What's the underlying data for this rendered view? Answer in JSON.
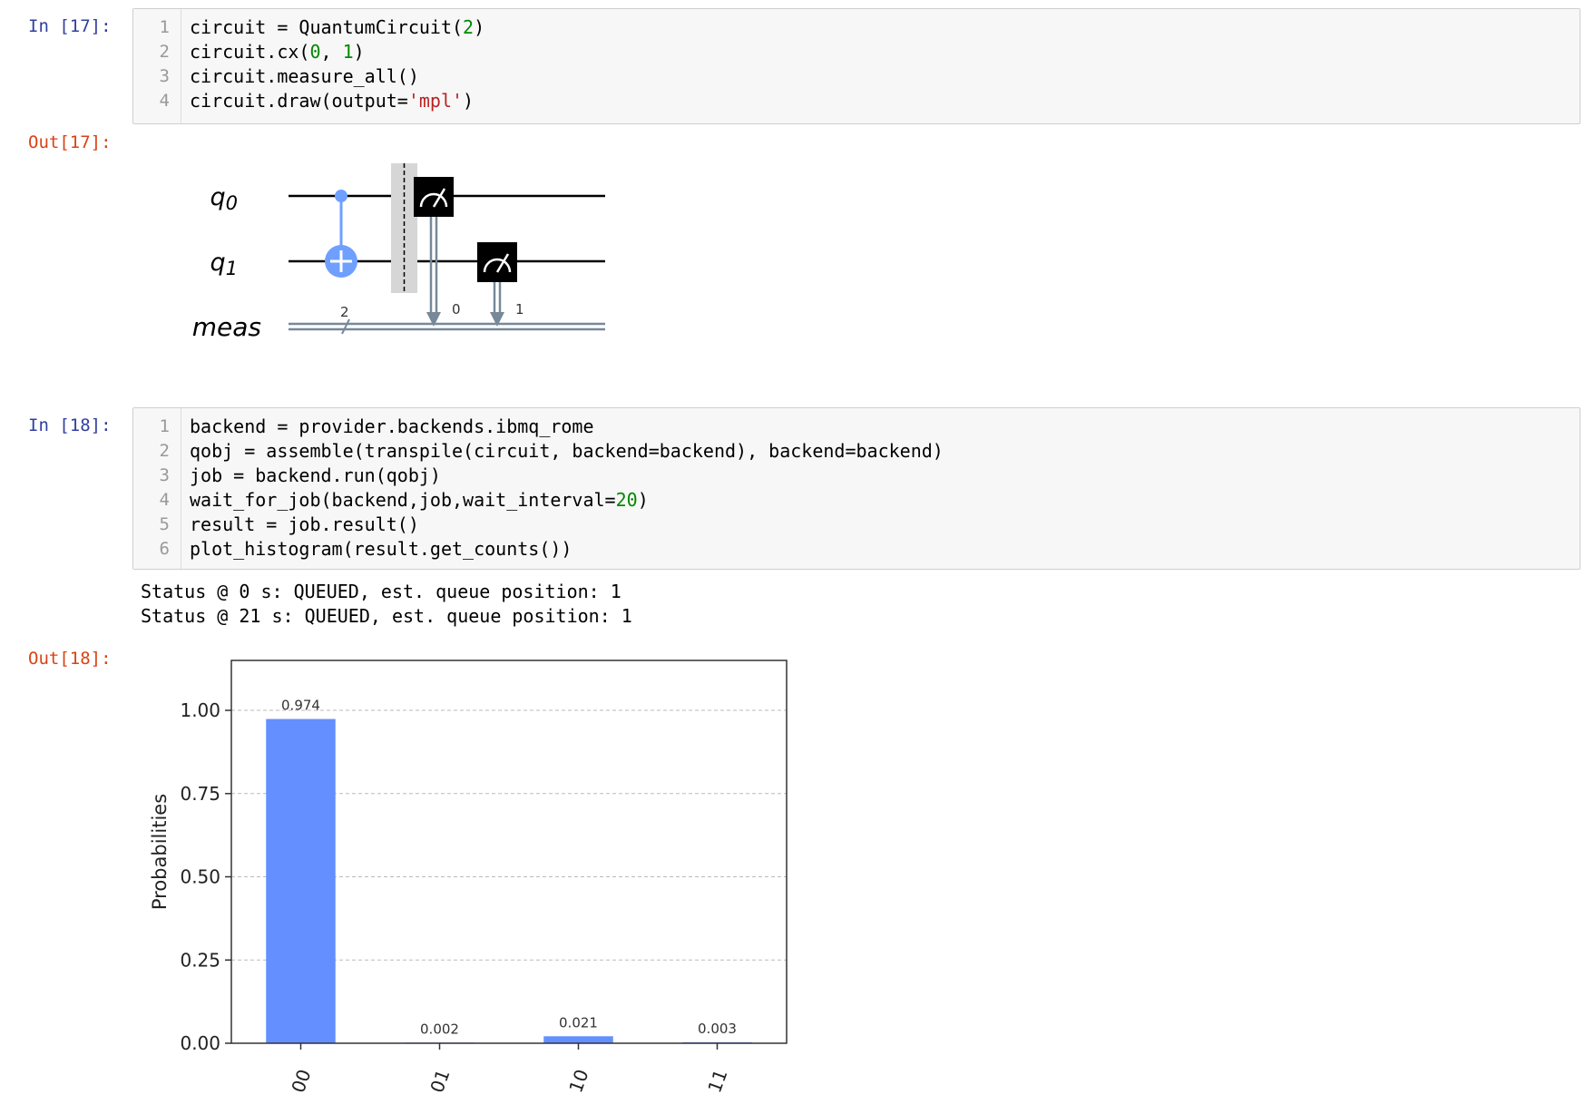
{
  "cell17": {
    "in_prompt": "In [17]:",
    "out_prompt": "Out[17]:",
    "line_numbers": [
      "1",
      "2",
      "3",
      "4"
    ],
    "code": [
      [
        {
          "t": "circuit = QuantumCircuit(",
          "c": ""
        },
        {
          "t": "2",
          "c": "num"
        },
        {
          "t": ")",
          "c": ""
        }
      ],
      [
        {
          "t": "circuit.cx(",
          "c": ""
        },
        {
          "t": "0",
          "c": "num"
        },
        {
          "t": ", ",
          "c": ""
        },
        {
          "t": "1",
          "c": "num"
        },
        {
          "t": ")",
          "c": ""
        }
      ],
      [
        {
          "t": "circuit.measure_all()",
          "c": ""
        }
      ],
      [
        {
          "t": "circuit.draw(output=",
          "c": ""
        },
        {
          "t": "'mpl'",
          "c": "str"
        },
        {
          "t": ")",
          "c": ""
        }
      ]
    ]
  },
  "circuit": {
    "qubit_labels": [
      "q",
      "q"
    ],
    "qubit_subscripts": [
      "0",
      "1"
    ],
    "classical_label": "meas",
    "bus_width": "2",
    "measure_bits": [
      "0",
      "1"
    ],
    "colors": {
      "gate": "#6f9fff",
      "wire": "#000000",
      "classical": "#778899",
      "barrier": "#d6d6d6"
    }
  },
  "cell18": {
    "in_prompt": "In [18]:",
    "out_prompt": "Out[18]:",
    "line_numbers": [
      "1",
      "2",
      "3",
      "4",
      "5",
      "6"
    ],
    "code": [
      [
        {
          "t": "backend = provider.backends.ibmq_rome",
          "c": ""
        }
      ],
      [
        {
          "t": "qobj = assemble(transpile(circuit, backend=backend), backend=backend)",
          "c": ""
        }
      ],
      [
        {
          "t": "job = backend.run(qobj)",
          "c": ""
        }
      ],
      [
        {
          "t": "wait_for_job(backend,job,wait_interval=",
          "c": ""
        },
        {
          "t": "20",
          "c": "num"
        },
        {
          "t": ")",
          "c": ""
        }
      ],
      [
        {
          "t": "result = job.result()",
          "c": ""
        }
      ],
      [
        {
          "t": "plot_histogram(result.get_counts())",
          "c": ""
        }
      ]
    ],
    "stdout": [
      "Status @ 0 s: QUEUED, est. queue position: 1",
      "Status @ 21 s: QUEUED, est. queue position: 1"
    ]
  },
  "chart_data": {
    "type": "bar",
    "categories": [
      "00",
      "01",
      "10",
      "11"
    ],
    "values": [
      0.974,
      0.002,
      0.021,
      0.003
    ],
    "value_labels": [
      "0.974",
      "0.002",
      "0.021",
      "0.003"
    ],
    "ylabel": "Probabilities",
    "ylim": [
      0,
      1.15
    ],
    "yticks": [
      0.0,
      0.25,
      0.5,
      0.75,
      1.0
    ],
    "ytick_labels": [
      "0.00",
      "0.25",
      "0.50",
      "0.75",
      "1.00"
    ],
    "grid": "horizontal-dashed",
    "bar_color": "#648fff"
  }
}
